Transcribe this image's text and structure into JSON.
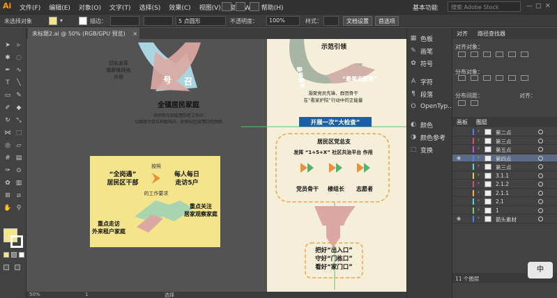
{
  "app": {
    "logo": "Ai"
  },
  "menu": [
    "文件(F)",
    "编辑(E)",
    "对象(O)",
    "文字(T)",
    "选择(S)",
    "效果(C)",
    "视图(V)",
    "窗口(W)",
    "帮助(H)"
  ],
  "workspace": "基本功能",
  "stock_search": "搜索 Adobe Stock",
  "controlbar": {
    "selection": "未选择对象",
    "stroke_label": "描边：",
    "brush": "5 点圆形",
    "opacity_label": "不透明度：",
    "opacity_value": "100%",
    "style_label": "样式：",
    "doc_setup": "文档设置",
    "preferences": "首选项"
  },
  "doc_tab": {
    "title": "未标题2.ai @ 50% (RGB/GPU 预览)",
    "close": "×"
  },
  "status": {
    "zoom": "50%",
    "page": "1",
    "tool": "选择"
  },
  "artboard_left": {
    "top_text": "切实发挥\n楼群微网格\n作用",
    "arrow_labels": [
      "号",
      "召"
    ],
    "heading": "全镇居民家庭",
    "subtext": "共同参与到疫情防控工作中\n以家庭为单位积极响应，织密社区疫情防控网络",
    "card": {
      "top": "按照",
      "left": "“全岗通”\n居民区干部",
      "right": "每人每日\n走访5户",
      "mid": "的工作要求",
      "bottom_right": "重点关注\n居家观察家庭",
      "bottom_left": "重点走访\n外来租户家庭"
    }
  },
  "artboard_right": {
    "top_title": "示范引领",
    "youth": "最美青年",
    "volunteer": "“最美志愿者”",
    "unite": "凝聚党员先锋、群团骨干\n在“看家护院”行动中的正能量",
    "banner": "开展一次“大检查”",
    "party_branch": "居民区党总支",
    "platform": "发挥 “1+5+X” 社区共治平台 作用",
    "roles": [
      "党员骨干",
      "楼组长",
      "志愿者"
    ],
    "guards": [
      "把好“出入口”",
      "守好“门栋口”",
      "看好“家门口”"
    ]
  },
  "dock": [
    {
      "icon": "swatches-icon",
      "glyph": "▦",
      "label": "色板"
    },
    {
      "icon": "brush-icon",
      "glyph": "✎",
      "label": "画笔"
    },
    {
      "icon": "symbol-icon",
      "glyph": "✿",
      "label": "符号"
    },
    {
      "icon": "character-icon",
      "glyph": "A",
      "label": "字符"
    },
    {
      "icon": "paragraph-icon",
      "glyph": "¶",
      "label": "段落"
    },
    {
      "icon": "opentype-icon",
      "glyph": "O",
      "label": "OpenTyp..."
    },
    {
      "icon": "color-icon",
      "glyph": "◐",
      "label": "颜色"
    },
    {
      "icon": "color-guide-icon",
      "glyph": "◑",
      "label": "颜色参考"
    },
    {
      "icon": "transform-icon",
      "glyph": "⬚",
      "label": "变换"
    }
  ],
  "align_panel": {
    "tabs": [
      "对齐",
      "路径查找器"
    ],
    "align_objects": "对齐对象：",
    "distribute_objects": "分布对象：",
    "distribute_spacing": "分布间距：",
    "align_to": "对齐："
  },
  "layers_panel": {
    "tabs": [
      "画板",
      "图层"
    ],
    "layers": [
      {
        "name": "第二点",
        "color": "#4f7bff",
        "visible": false,
        "selected": false
      },
      {
        "name": "第三点",
        "color": "#e24a6b",
        "visible": false,
        "selected": false
      },
      {
        "name": "第五点",
        "color": "#d048e0",
        "visible": false,
        "selected": false
      },
      {
        "name": "第四点",
        "color": "#4f7bff",
        "visible": true,
        "selected": true
      },
      {
        "name": "第三点",
        "color": "#4fd9e8",
        "visible": false,
        "selected": false
      },
      {
        "name": "3.1.1",
        "color": "#d9d94f",
        "visible": false,
        "selected": false
      },
      {
        "name": "2.1.2",
        "color": "#e24a6b",
        "visible": false,
        "selected": false
      },
      {
        "name": "2.1.1",
        "color": "#ffb347",
        "visible": false,
        "selected": false
      },
      {
        "name": "2.1",
        "color": "#4fd9e8",
        "visible": false,
        "selected": false
      },
      {
        "name": "1",
        "color": "#7cd15e",
        "visible": false,
        "selected": false
      },
      {
        "name": "箭头素材",
        "color": "#4f7bff",
        "visible": true,
        "selected": false
      }
    ],
    "footer": "11 个图层"
  },
  "badge": "中",
  "colors": {
    "card_yellow": "#f4e58d",
    "artboard_bg": "#f5efd9",
    "banner_blue": "#1b5fa8",
    "dash_orange": "#f0a24a",
    "arrow_pink": "#dba9a2",
    "arrow_blue": "#a9d4e0",
    "arrow_green": "#a9d4b0"
  }
}
